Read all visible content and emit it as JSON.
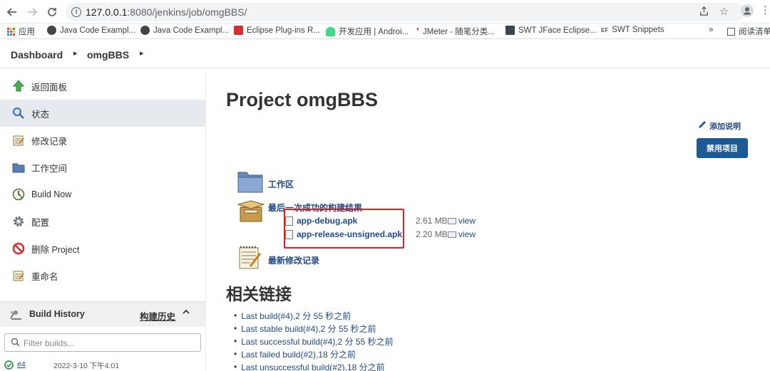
{
  "browser": {
    "url_host": "127.0.0.1",
    "url_path": ":8080/jenkins/job/omgBBS/",
    "bookmarks": [
      {
        "label": "应用"
      },
      {
        "label": "Java Code Exampl..."
      },
      {
        "label": "Java Code Exampl..."
      },
      {
        "label": "Eclipse Plug-ins R..."
      },
      {
        "label": "开发应用 | Androi..."
      },
      {
        "label": "JMeter - 随笔分类..."
      },
      {
        "label": "SWT JFace Eclipse..."
      },
      {
        "label": "SWT Snippets"
      },
      {
        "label": "»"
      },
      {
        "label": "阅读清单"
      }
    ]
  },
  "breadcrumb": {
    "root": "Dashboard",
    "job": "omgBBS",
    "sep": "▸"
  },
  "sidebar": {
    "tasks": [
      {
        "label": "返回面板",
        "icon": "up-arrow-icon"
      },
      {
        "label": "状态",
        "icon": "search-icon"
      },
      {
        "label": "修改记录",
        "icon": "notepad-icon"
      },
      {
        "label": "工作空间",
        "icon": "folder-icon"
      },
      {
        "label": "Build Now",
        "icon": "clock-play-icon"
      },
      {
        "label": "配置",
        "icon": "gear-icon"
      },
      {
        "label": "删除 Project",
        "icon": "no-entry-icon"
      },
      {
        "label": "重命名",
        "icon": "notepad-icon"
      }
    ],
    "history": {
      "title": "Build History",
      "trend": "构建历史",
      "filter_placeholder": "Filter builds...",
      "builds": [
        {
          "number": "#4",
          "time": "2022-3-10 下午4:01"
        }
      ]
    }
  },
  "main": {
    "title": "Project omgBBS",
    "add_description": "添加说明",
    "disable_button": "禁用项目",
    "workspace_link": "工作区",
    "last_success_link": "最后一次成功的构建结果",
    "artifacts": [
      {
        "name": "app-debug.apk",
        "size": "2.61 MB",
        "view": "view"
      },
      {
        "name": "app-release-unsigned.apk",
        "size": "2.20 MB",
        "view": "view"
      }
    ],
    "changes_link": "最新修改记录",
    "permalinks_title": "相关链接",
    "permalinks": [
      "Last build(#4),2 分 55 秒之前",
      "Last stable build(#4),2 分 55 秒之前",
      "Last successful build(#4),2 分 55 秒之前",
      "Last failed build(#2),18 分之前",
      "Last unsuccessful build(#2),18 分之前"
    ]
  },
  "colors": {
    "link": "#204a87",
    "button": "#1c5a96",
    "highlight_box": "#e02020",
    "active_task": "#e6e9ee"
  }
}
